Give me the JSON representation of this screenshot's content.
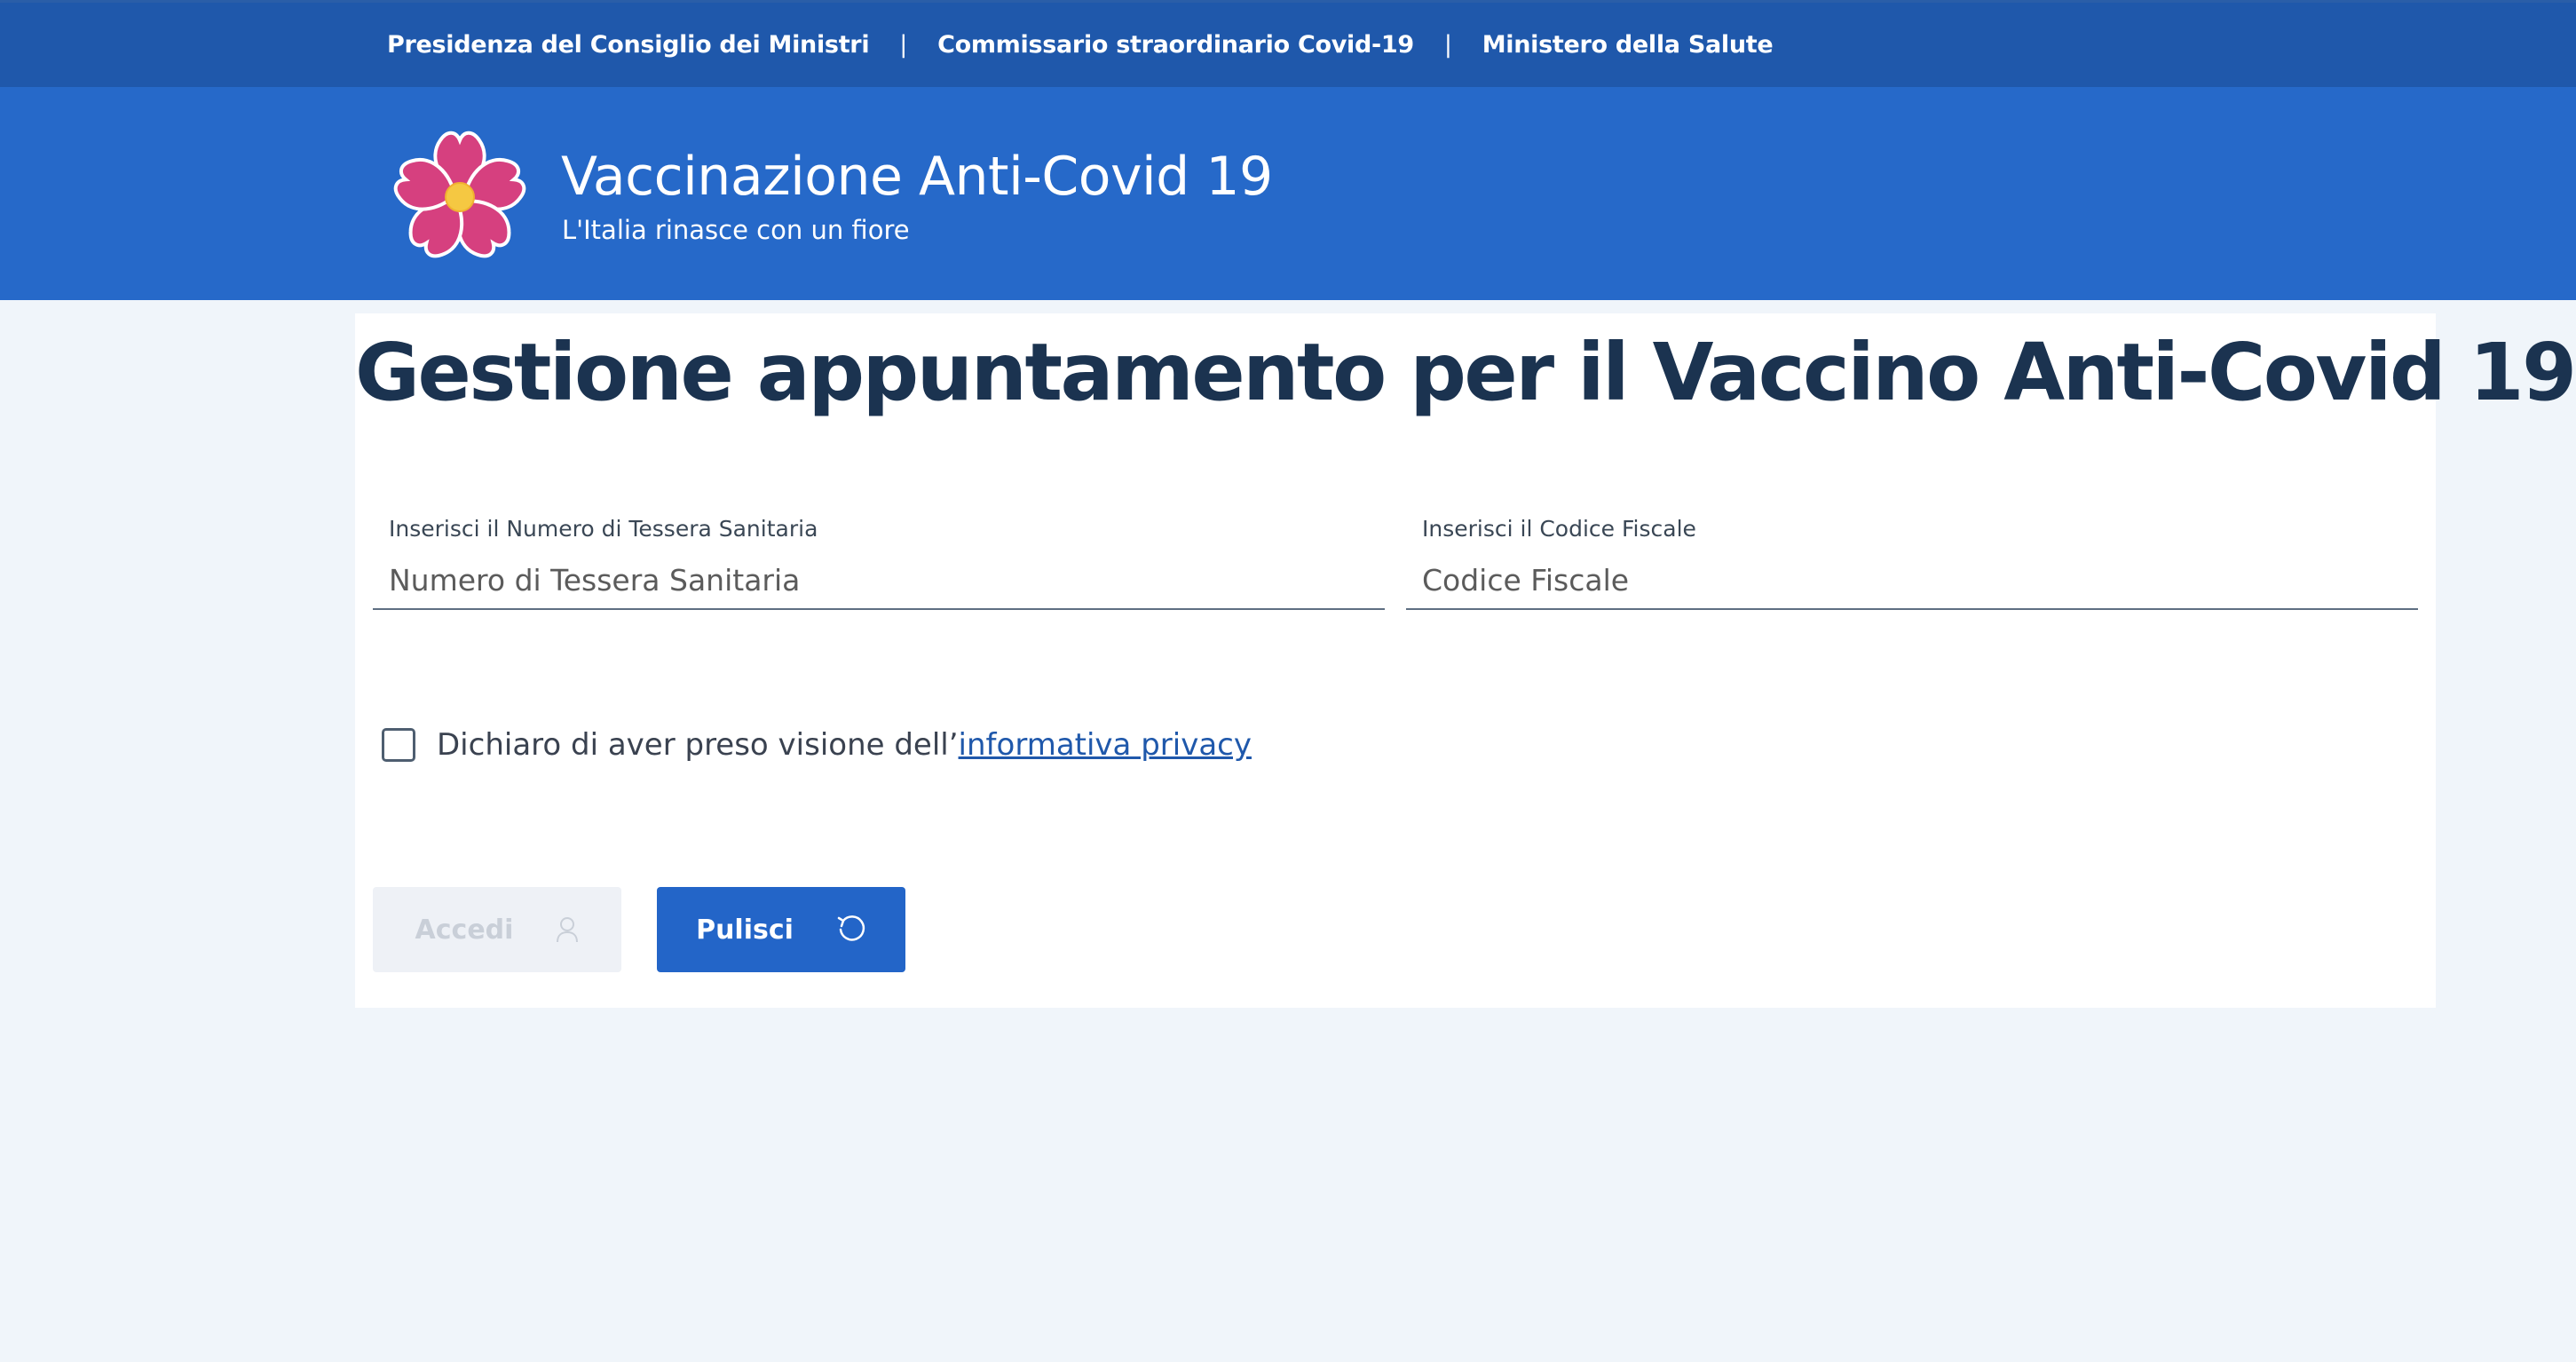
{
  "topbar": {
    "links": [
      "Presidenza del Consiglio dei Ministri",
      "Commissario straordinario Covid-19",
      "Ministero della Salute"
    ],
    "separator": "|"
  },
  "header": {
    "title": "Vaccinazione Anti-Covid 19",
    "subtitle": "L'Italia rinasce con un fiore",
    "logo_icon": "primula-flower-icon"
  },
  "main": {
    "page_title": "Gestione appuntamento per il Vaccino Anti-Covid 19",
    "fields": [
      {
        "label": "Inserisci il Numero di Tessera Sanitaria",
        "placeholder": "Numero di Tessera Sanitaria",
        "value": ""
      },
      {
        "label": "Inserisci il Codice Fiscale",
        "placeholder": "Codice Fiscale",
        "value": ""
      }
    ],
    "privacy": {
      "text": "Dichiaro di aver preso visione dell’",
      "link": "informativa privacy",
      "checked": false
    },
    "buttons": {
      "accedi": {
        "label": "Accedi",
        "icon": "user-icon",
        "disabled": true
      },
      "pulisci": {
        "label": "Pulisci",
        "icon": "refresh-icon"
      }
    }
  },
  "colors": {
    "topbar": "#1f58ab",
    "header": "#2669c9",
    "background": "#f0f5fa",
    "title_text": "#1b3350",
    "primary_button": "#2365c8",
    "flower_petals": "#d6407f",
    "flower_center": "#f5c842"
  }
}
